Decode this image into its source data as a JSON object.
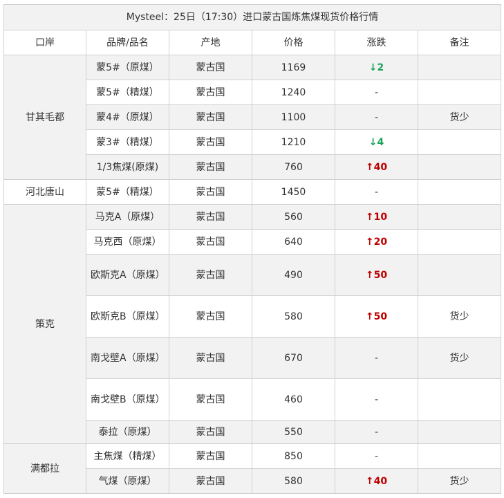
{
  "title": "Mysteel：25日（17:30）进口蒙古国炼焦煤现货价格行情",
  "headers": {
    "port": "口岸",
    "brand": "品牌/品名",
    "origin": "产地",
    "price": "价格",
    "change": "涨跌",
    "note": "备注"
  },
  "ports": [
    {
      "name": "甘其毛都",
      "rows": [
        {
          "brand": "蒙5#（原煤）",
          "origin": "蒙古国",
          "price": "1169",
          "change": "2",
          "direction": "down",
          "note": ""
        },
        {
          "brand": "蒙5#（精煤）",
          "origin": "蒙古国",
          "price": "1240",
          "change": "-",
          "direction": "none",
          "note": ""
        },
        {
          "brand": "蒙4#（原煤）",
          "origin": "蒙古国",
          "price": "1100",
          "change": "-",
          "direction": "none",
          "note": "货少"
        },
        {
          "brand": "蒙3#（精煤）",
          "origin": "蒙古国",
          "price": "1210",
          "change": "4",
          "direction": "down",
          "note": ""
        },
        {
          "brand": "1/3焦煤(原煤)",
          "origin": "蒙古国",
          "price": "760",
          "change": "40",
          "direction": "up",
          "note": ""
        }
      ]
    },
    {
      "name": "河北唐山",
      "rows": [
        {
          "brand": "蒙5#（精煤）",
          "origin": "蒙古国",
          "price": "1450",
          "change": "-",
          "direction": "none",
          "note": ""
        }
      ]
    },
    {
      "name": "策克",
      "rows": [
        {
          "brand": "马克A（原煤）",
          "origin": "蒙古国",
          "price": "560",
          "change": "10",
          "direction": "up",
          "note": ""
        },
        {
          "brand": "马克西（原煤）",
          "origin": "蒙古国",
          "price": "640",
          "change": "20",
          "direction": "up",
          "note": ""
        },
        {
          "brand": "欧斯克A（原煤）",
          "origin": "蒙古国",
          "price": "490",
          "change": "50",
          "direction": "up",
          "note": ""
        },
        {
          "brand": "欧斯克B（原煤）",
          "origin": "蒙古国",
          "price": "580",
          "change": "50",
          "direction": "up",
          "note": "货少"
        },
        {
          "brand": "南戈壁A（原煤）",
          "origin": "蒙古国",
          "price": "670",
          "change": "-",
          "direction": "none",
          "note": "货少"
        },
        {
          "brand": "南戈壁B（原煤）",
          "origin": "蒙古国",
          "price": "460",
          "change": "-",
          "direction": "none",
          "note": ""
        },
        {
          "brand": "泰拉（原煤）",
          "origin": "蒙古国",
          "price": "550",
          "change": "-",
          "direction": "none",
          "note": ""
        }
      ]
    },
    {
      "name": "满都拉",
      "rows": [
        {
          "brand": "主焦煤（精煤）",
          "origin": "蒙古国",
          "price": "850",
          "change": "-",
          "direction": "none",
          "note": ""
        },
        {
          "brand": "气煤（原煤）",
          "origin": "蒙古国",
          "price": "580",
          "change": "40",
          "direction": "up",
          "note": "货少"
        }
      ]
    }
  ],
  "arrows": {
    "up": "↑",
    "down": "↓"
  },
  "colors": {
    "up": "#c00000",
    "down": "#1aa35a",
    "shade": "#f2f2f2",
    "border": "#d0d0d0"
  }
}
